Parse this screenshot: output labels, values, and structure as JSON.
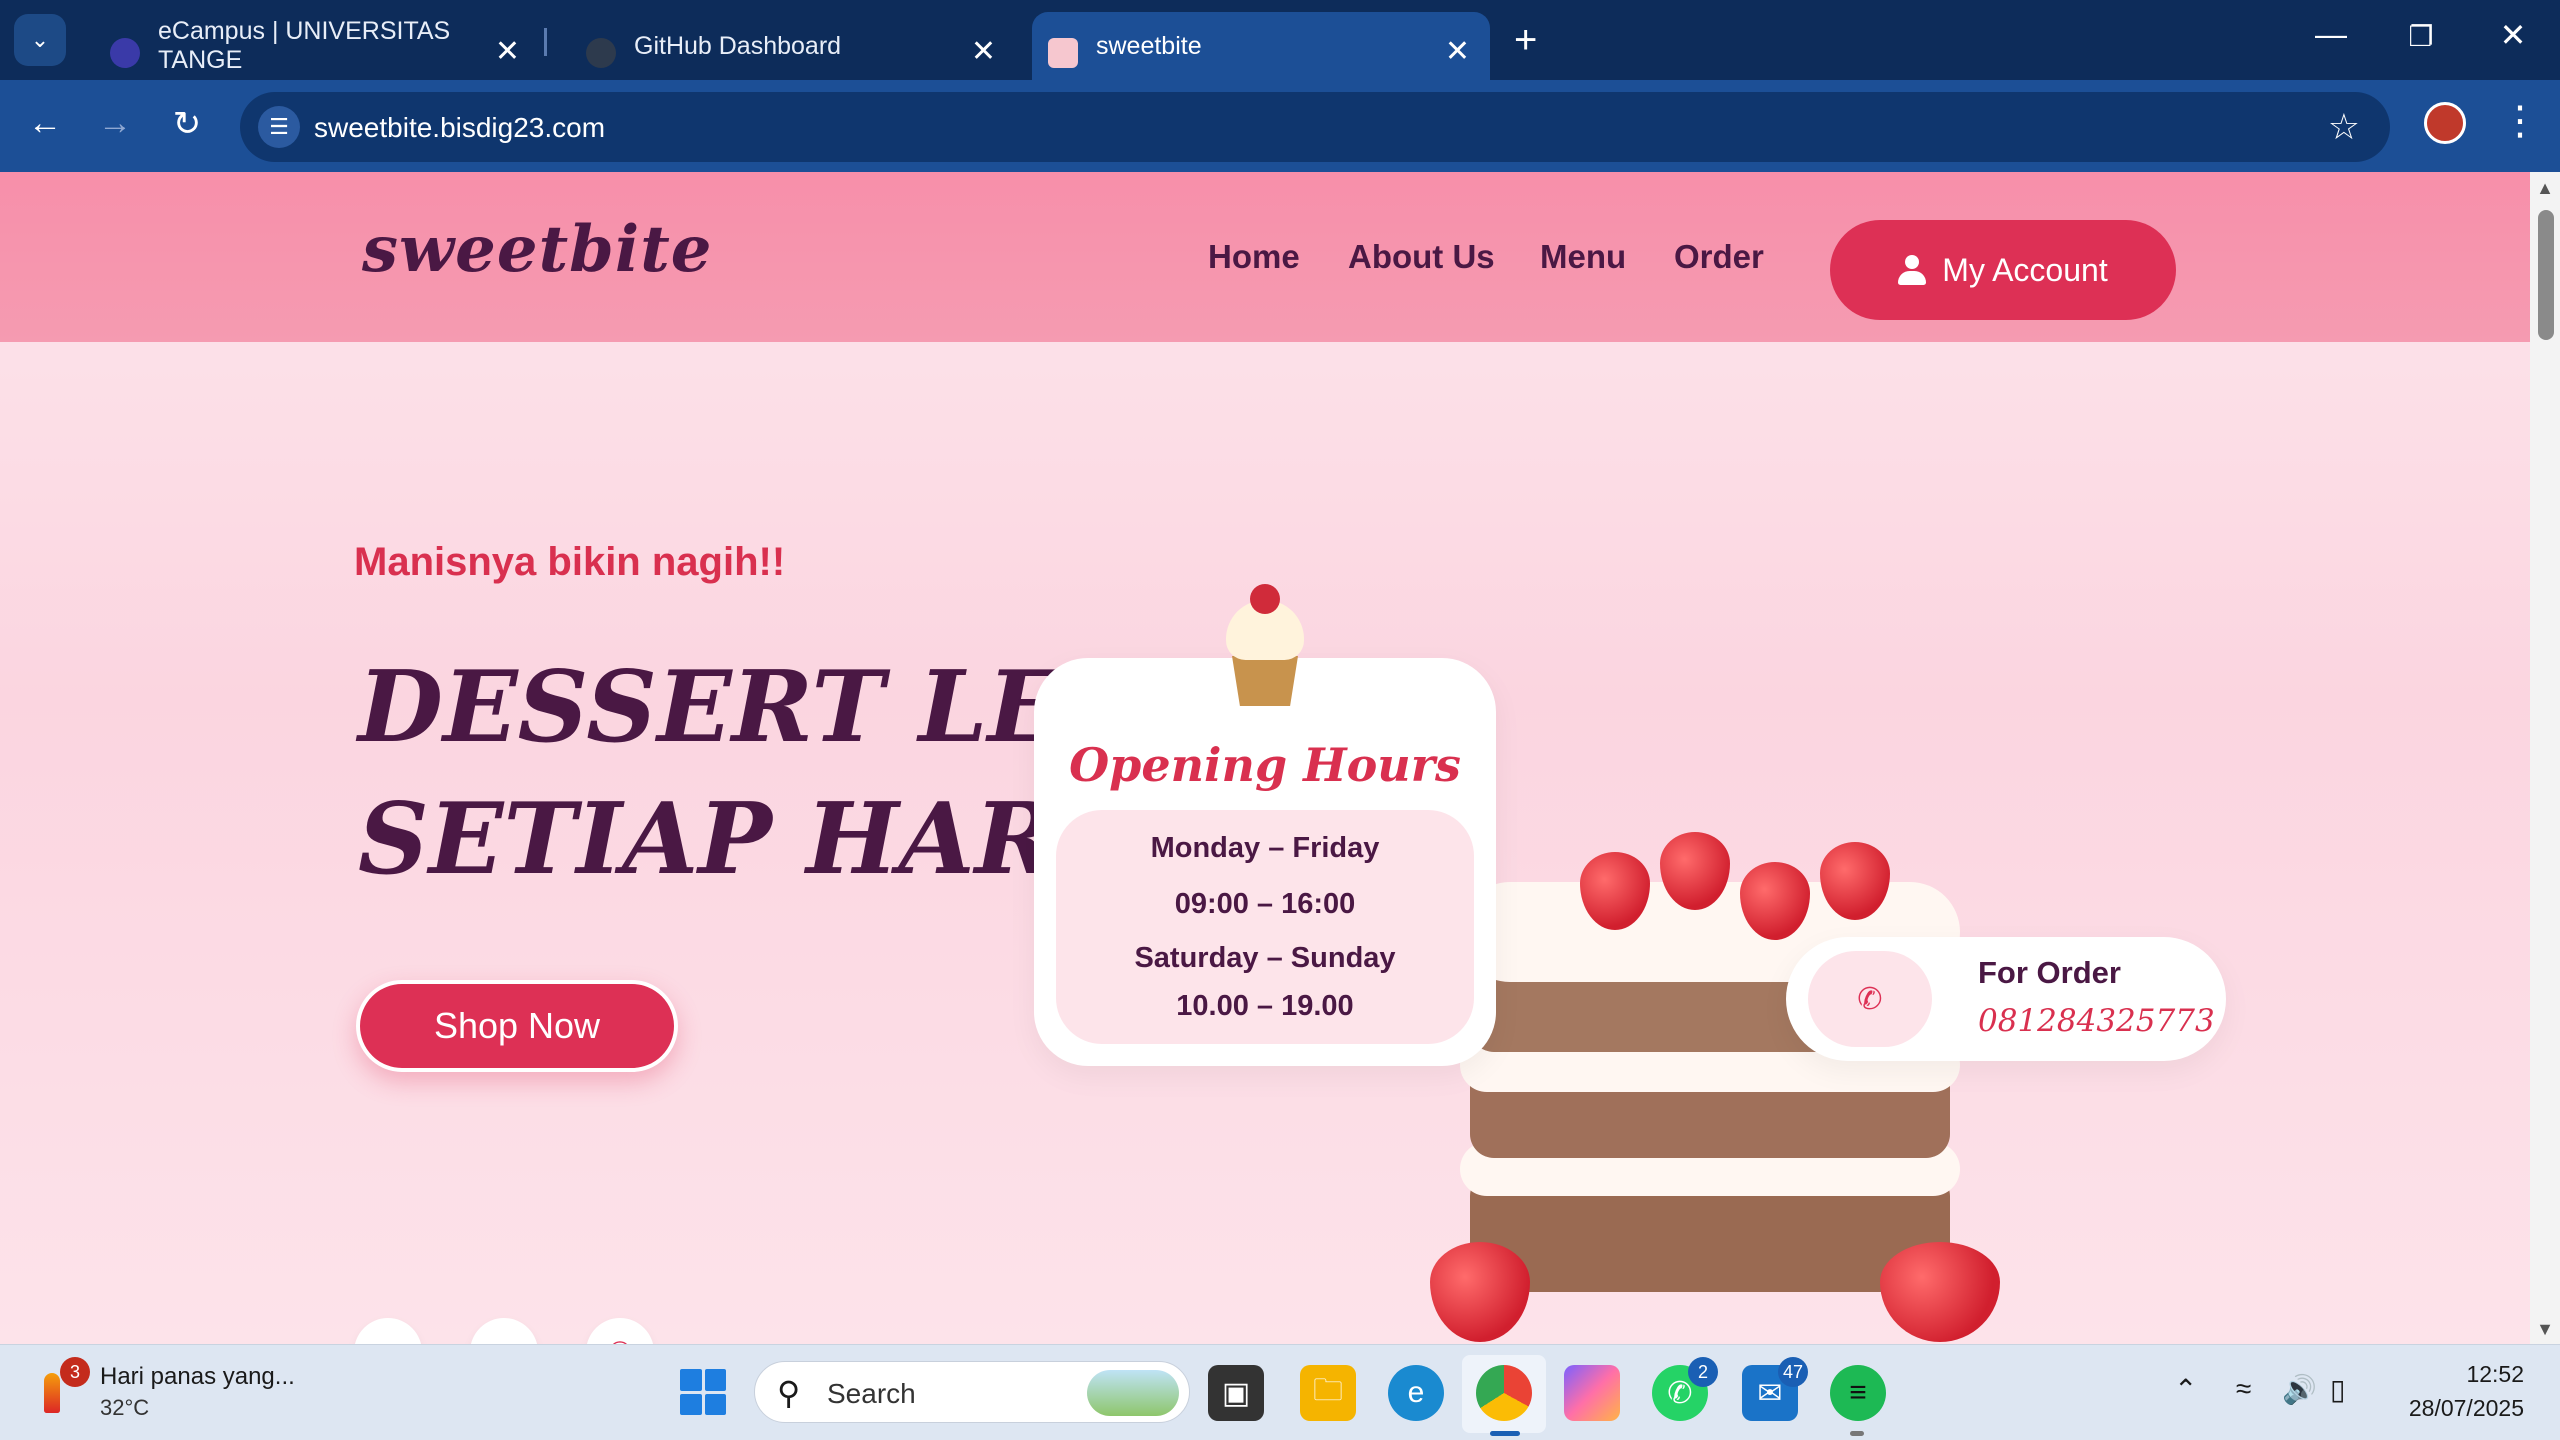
{
  "browser": {
    "tabs": [
      {
        "title": "eCampus | UNIVERSITAS TANGE"
      },
      {
        "title": "GitHub Dashboard"
      },
      {
        "title": "sweetbite"
      }
    ],
    "url": "sweetbite.bisdig23.com"
  },
  "site": {
    "logo": "sweetbite",
    "nav": [
      {
        "label": "Home"
      },
      {
        "label": "About Us"
      },
      {
        "label": "Menu"
      },
      {
        "label": "Order"
      }
    ],
    "account_label": "My Account"
  },
  "hero": {
    "tagline": "Manisnya bikin nagih!!",
    "title_line1": "DESSERT LEZAT",
    "title_line2": "SETIAP HARI",
    "cta": "Shop Now",
    "socials": [
      {
        "icon": "instagram-icon"
      },
      {
        "icon": "tiktok-icon"
      },
      {
        "icon": "whatsapp-icon"
      }
    ]
  },
  "opening_hours": {
    "title": "Opening Hours",
    "weekday_label": "Monday – Friday",
    "weekday_time": "09:00 – 16:00",
    "weekend_label": "Saturday – Sunday",
    "weekend_time": "10.00 – 19.00"
  },
  "order": {
    "label": "For Order",
    "phone": "081284325773"
  },
  "taskbar": {
    "weather_badge": "3",
    "weather_text": "Hari panas yang...",
    "weather_temp": "32°C",
    "search_placeholder": "Search",
    "whatsapp_badge": "2",
    "mail_badge": "47",
    "time": "12:52",
    "date": "28/07/2025"
  },
  "colors": {
    "brand_pink": "#dd3055",
    "header_pink": "#f78faa",
    "brand_plum": "#4a1844",
    "chrome_blue": "#1c4f96"
  }
}
